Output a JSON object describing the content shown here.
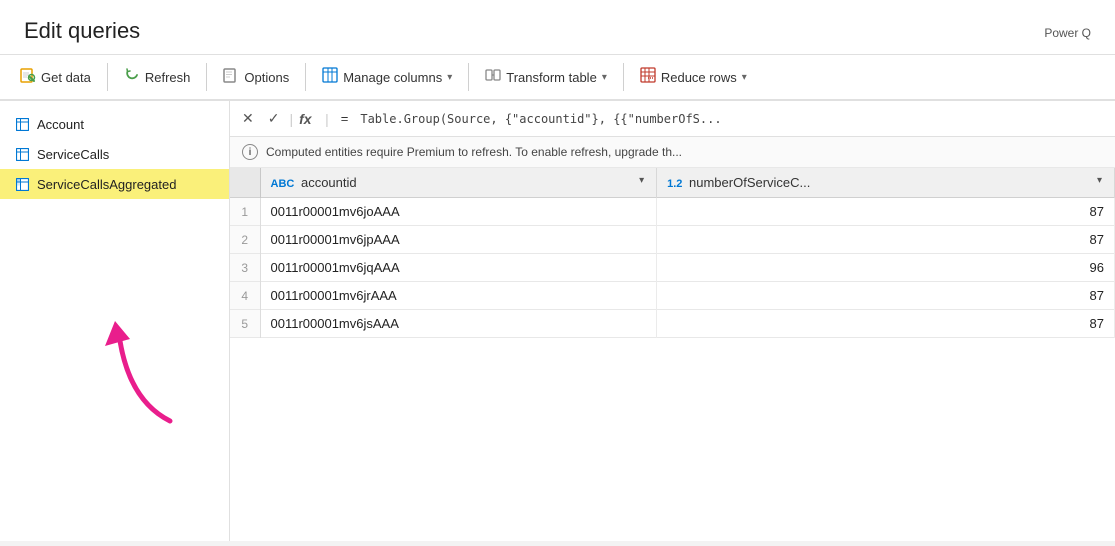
{
  "app": {
    "power_label": "Power Q",
    "title": "Edit queries"
  },
  "toolbar": {
    "buttons": [
      {
        "id": "get-data",
        "label": "Get data",
        "icon": "📄",
        "has_dropdown": false
      },
      {
        "id": "refresh",
        "label": "Refresh",
        "icon": "🔄",
        "has_dropdown": false
      },
      {
        "id": "options",
        "label": "Options",
        "icon": "📋",
        "has_dropdown": false
      },
      {
        "id": "manage-columns",
        "label": "Manage columns",
        "icon": "⊞",
        "has_dropdown": true
      },
      {
        "id": "transform-table",
        "label": "Transform table",
        "icon": "⚙",
        "has_dropdown": true
      },
      {
        "id": "reduce-rows",
        "label": "Reduce rows",
        "icon": "▦",
        "has_dropdown": true
      }
    ]
  },
  "sidebar": {
    "items": [
      {
        "id": "account",
        "label": "Account",
        "active": false
      },
      {
        "id": "service-calls",
        "label": "ServiceCalls",
        "active": false
      },
      {
        "id": "service-calls-aggregated",
        "label": "ServiceCallsAggregated",
        "active": true
      }
    ]
  },
  "formula_bar": {
    "cancel_label": "✕",
    "confirm_label": "✓",
    "fx_label": "fx",
    "eq_label": "=",
    "formula": "Table.Group(Source, {\"accountid\"}, {{\"numberOfS..."
  },
  "info_bar": {
    "message": "Computed entities require Premium to refresh. To enable refresh, upgrade th..."
  },
  "table": {
    "columns": [
      {
        "id": "accountid",
        "type": "ABC",
        "label": "accountid",
        "has_filter": true
      },
      {
        "id": "numberOfServiceC",
        "type": "1.2",
        "label": "numberOfServiceC...",
        "has_filter": true
      }
    ],
    "rows": [
      {
        "num": 1,
        "accountid": "0011r00001mv6joAAA",
        "value": 87
      },
      {
        "num": 2,
        "accountid": "0011r00001mv6jpAAA",
        "value": 87
      },
      {
        "num": 3,
        "accountid": "0011r00001mv6jqAAA",
        "value": 96
      },
      {
        "num": 4,
        "accountid": "0011r00001mv6jrAAA",
        "value": 87
      },
      {
        "num": 5,
        "accountid": "0011r00001mv6jsAAA",
        "value": 87
      }
    ]
  }
}
